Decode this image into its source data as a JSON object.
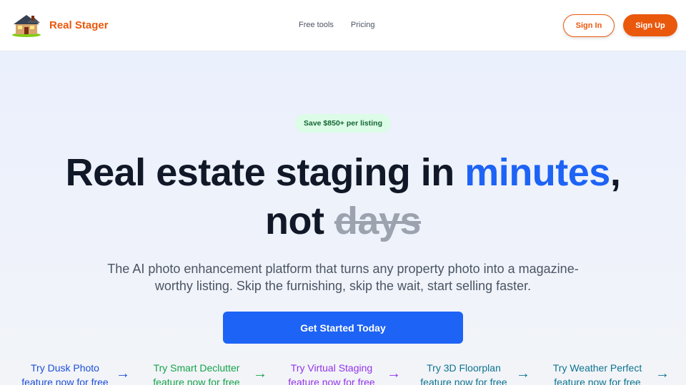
{
  "header": {
    "brand": "Real Stager",
    "nav": [
      "Free tools",
      "Pricing"
    ],
    "sign_in": "Sign In",
    "sign_up": "Sign Up"
  },
  "hero": {
    "badge": "Save $850+ per listing",
    "headline_part1": "Real estate staging in ",
    "headline_accent": "minutes",
    "headline_comma": ",",
    "headline_not": "not ",
    "headline_strike": "days",
    "subtitle": "The AI photo enhancement platform that turns any property photo into a magazine-worthy listing. Skip the furnishing, skip the wait, start selling faster.",
    "cta": "Get Started Today"
  },
  "tools": [
    {
      "line1": "Try Dusk Photo",
      "line2": "feature now for free",
      "arrow": "→",
      "color": "#1d4ed8"
    },
    {
      "line1": "Try Smart Declutter",
      "line2": "feature now for free",
      "arrow": "→",
      "color": "#16a34a"
    },
    {
      "line1": "Try Virtual Staging",
      "line2": "feature now for free",
      "arrow": "→",
      "color": "#9333ea"
    },
    {
      "line1": "Try 3D Floorplan",
      "line2": "feature now for free",
      "arrow": "→",
      "color": "#0e7490"
    },
    {
      "line1": "Try Weather Perfect",
      "line2": "feature now for free",
      "arrow": "→",
      "color": "#0e7490"
    }
  ],
  "colors": {
    "brand": "#ea580c",
    "accent": "#1d63f5",
    "badge_bg": "#dcfce7",
    "badge_text": "#166534"
  }
}
